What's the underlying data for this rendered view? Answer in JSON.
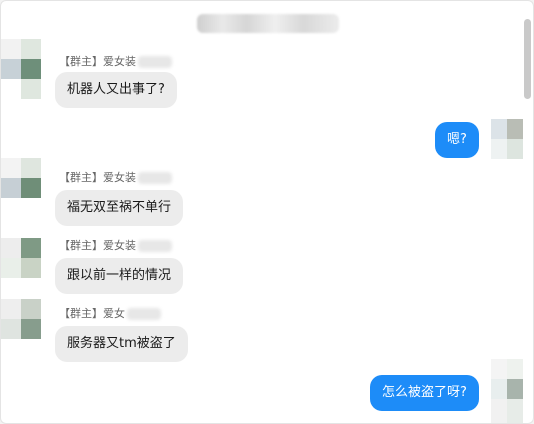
{
  "chat": {
    "messages": [
      {
        "direction": "in",
        "sender": "【群主】爱女装",
        "text": "机器人又出事了?"
      },
      {
        "direction": "out",
        "text": "嗯?"
      },
      {
        "direction": "in",
        "sender": "【群主】爱女装",
        "text": "福无双至祸不单行"
      },
      {
        "direction": "in",
        "sender": "【群主】爱女装",
        "text": "跟以前一样的情况"
      },
      {
        "direction": "in",
        "sender": "【群主】爱女",
        "text": "服务器又tm被盗了"
      },
      {
        "direction": "out",
        "text": "怎么被盗了呀?"
      }
    ]
  },
  "colors": {
    "bubble_out": "#1d8cf8",
    "bubble_in": "#ececec",
    "background": "#ffffff"
  }
}
